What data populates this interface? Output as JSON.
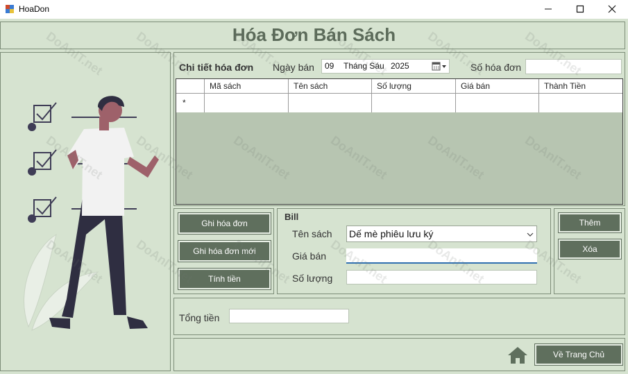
{
  "window": {
    "title": "HoaDon",
    "minimize": "—",
    "maximize": "☐",
    "close": "✕"
  },
  "header": {
    "title": "Hóa Đơn Bán Sách"
  },
  "details": {
    "section_label": "Chi tiết hóa đơn",
    "date_label": "Ngày bán",
    "date_day": "09",
    "date_month": "Tháng Sáu",
    "date_year": "2025",
    "invoice_no_label": "Số hóa đơn",
    "invoice_no_value": ""
  },
  "grid": {
    "columns": [
      "Mã sách",
      "Tên sách",
      "Số lượng",
      "Giá bán",
      "Thành Tiền"
    ],
    "new_row_marker": "*"
  },
  "left_buttons": {
    "save": "Ghi hóa đơn",
    "save_new": "Ghi hóa đơn mới",
    "calculate": "Tính tiền"
  },
  "bill": {
    "group_label": "Bill",
    "book_name_label": "Tên sách",
    "book_name_value": "Dế mè phiêu lưu ký",
    "price_label": "Giá bán",
    "price_value": "",
    "quantity_label": "Số lượng",
    "quantity_value": ""
  },
  "right_buttons": {
    "add": "Thêm",
    "delete": "Xóa"
  },
  "total": {
    "label": "Tổng tiền",
    "value": ""
  },
  "footer": {
    "home_button": "Về Trang Chủ"
  },
  "colors": {
    "background": "#d6e3d0",
    "button": "#5f6f5d",
    "title_text": "#5c6b5a",
    "grid_body": "#b7c5b1"
  },
  "watermark": "DoAnIT.net"
}
